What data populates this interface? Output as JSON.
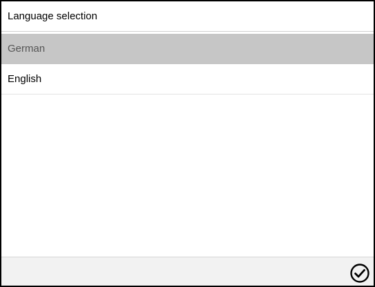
{
  "header": {
    "title": "Language selection"
  },
  "languages": {
    "selected_index": 0,
    "items": [
      {
        "label": "German"
      },
      {
        "label": "English"
      }
    ]
  },
  "footer": {
    "confirm_icon": "check-circle-icon"
  },
  "colors": {
    "selected_row": "#c6c6c6",
    "footer_bg": "#f2f2f2",
    "border": "#000000"
  }
}
